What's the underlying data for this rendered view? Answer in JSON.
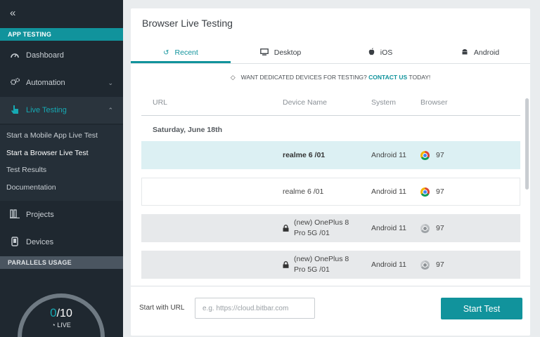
{
  "sidebar": {
    "collapse_icon": "«",
    "app_testing_header": "APP TESTING",
    "items": [
      {
        "label": "Dashboard",
        "icon": "dashboard-icon"
      },
      {
        "label": "Automation",
        "icon": "gears-icon"
      },
      {
        "label": "Live Testing",
        "icon": "hand-pointer-icon"
      },
      {
        "label": "Projects",
        "icon": "projects-icon"
      },
      {
        "label": "Devices",
        "icon": "device-icon"
      }
    ],
    "sub_items": [
      {
        "label": "Start a Mobile App Live Test"
      },
      {
        "label": "Start a Browser Live Test"
      },
      {
        "label": "Test Results"
      },
      {
        "label": "Documentation"
      }
    ],
    "parallels_header": "PARALLELS USAGE",
    "gauge": {
      "used": "0",
      "total": "/10",
      "live_label": "LIVE",
      "fraction": 0
    }
  },
  "main": {
    "title": "Browser Live Testing",
    "tabs": [
      {
        "label": "Recent",
        "icon": "history-icon"
      },
      {
        "label": "Desktop",
        "icon": "monitor-icon"
      },
      {
        "label": "iOS",
        "icon": "apple-icon"
      },
      {
        "label": "Android",
        "icon": "android-icon"
      }
    ],
    "promo": {
      "text": "WANT DEDICATED DEVICES FOR TESTING? ",
      "link": "CONTACT US",
      "suffix": " TODAY!"
    },
    "table": {
      "headers": {
        "url": "URL",
        "device": "Device Name",
        "system": "System",
        "browser": "Browser"
      },
      "date_group": "Saturday, June 18th",
      "rows": [
        {
          "url": "",
          "device_line1": "realme 6 /01",
          "device_line2": "",
          "system": "Android 11",
          "browser_version": "97",
          "locked": false,
          "state": "selected"
        },
        {
          "url": "",
          "device_line1": "realme 6 /01",
          "device_line2": "",
          "system": "Android 11",
          "browser_version": "97",
          "locked": false,
          "state": "normal"
        },
        {
          "url": "",
          "device_line1": "(new) OnePlus 8",
          "device_line2": "Pro 5G /01",
          "system": "Android 11",
          "browser_version": "97",
          "locked": true,
          "state": "disabled"
        },
        {
          "url": "",
          "device_line1": "(new) OnePlus 8",
          "device_line2": "Pro 5G /01",
          "system": "Android 11",
          "browser_version": "97",
          "locked": true,
          "state": "disabled"
        }
      ]
    },
    "footer": {
      "label": "Start with URL",
      "input_placeholder": "e.g. https://cloud.bitbar.com",
      "input_value": "",
      "start_button": "Start Test"
    }
  },
  "colors": {
    "accent": "#11939c",
    "sidebar_bg": "#1f2830",
    "selected_row": "#dcf0f3",
    "disabled_row": "#e7e9eb"
  }
}
